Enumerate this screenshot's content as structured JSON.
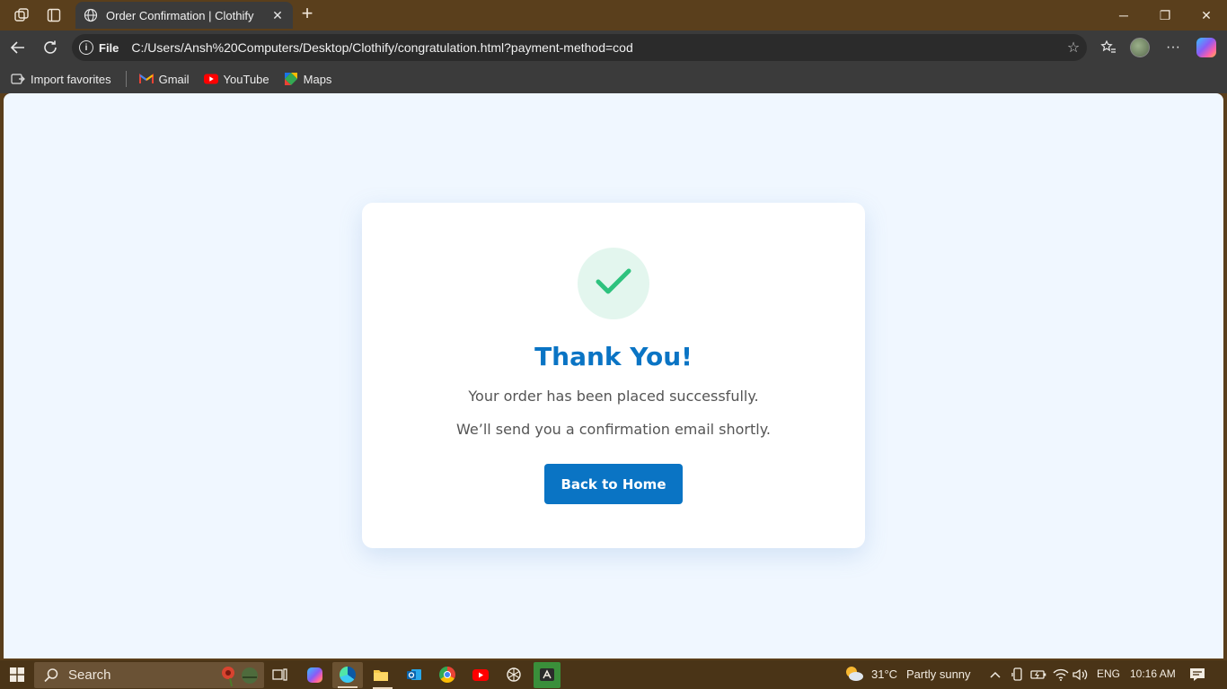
{
  "browser": {
    "tab_title": "Order Confirmation | Clothify",
    "tab_close": "✕",
    "new_tab": "+",
    "scheme_label": "File",
    "url": "C:/Users/Ansh%20Computers/Desktop/Clothify/congratulation.html?payment-method=cod",
    "window_controls": {
      "minimize": "─",
      "restore": "❐",
      "close": "✕"
    },
    "more": "···",
    "star": "☆"
  },
  "bookmarks": [
    {
      "label": "Import favorites",
      "icon": "import-icon"
    },
    {
      "label": "Gmail",
      "icon": "gmail-icon"
    },
    {
      "label": "YouTube",
      "icon": "youtube-icon"
    },
    {
      "label": "Maps",
      "icon": "maps-icon"
    }
  ],
  "page": {
    "heading": "Thank You!",
    "message_1": "Your order has been placed successfully.",
    "message_2": "We’ll send you a confirmation email shortly.",
    "button_label": "Back to Home",
    "accent_color": "#0a74c4",
    "success_color": "#2ec27e"
  },
  "taskbar": {
    "search_placeholder": "Search",
    "weather_temp": "31°C",
    "weather_text": "Partly sunny",
    "language": "ENG",
    "time": "10:16 AM"
  }
}
